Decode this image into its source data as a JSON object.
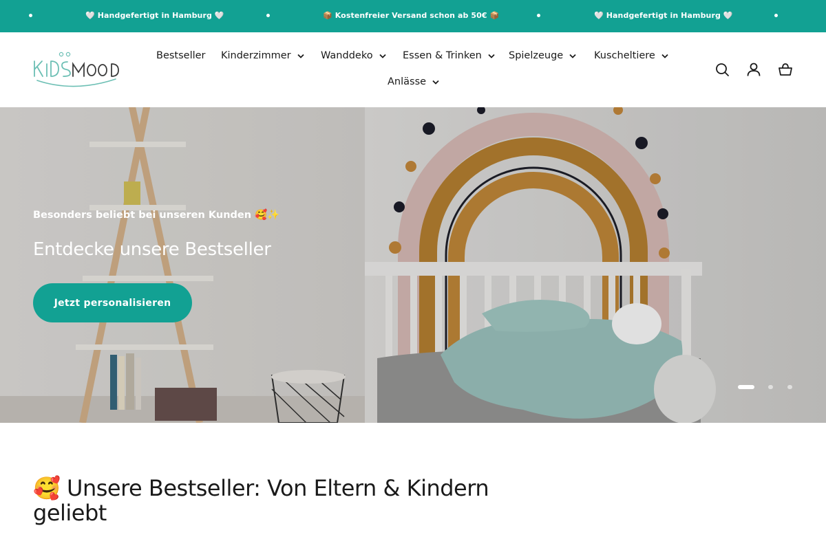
{
  "announcement": {
    "messages": [
      "🤍 Handgefertigt in Hamburg 🤍",
      "📦 Kostenfreier Versand schon ab 50€ 📦",
      "🤍 Handgefertigt in Hamburg 🤍"
    ]
  },
  "header": {
    "logo_text": "KIDSMOOD",
    "nav": [
      {
        "label": "Bestseller",
        "has_dropdown": false
      },
      {
        "label": "Kinderzimmer",
        "has_dropdown": true
      },
      {
        "label": "Wanddeko",
        "has_dropdown": true
      },
      {
        "label": "Essen & Trinken",
        "has_dropdown": true
      },
      {
        "label": "Spielzeuge",
        "has_dropdown": true
      },
      {
        "label": "Kuscheltiere",
        "has_dropdown": true
      },
      {
        "label": "Anlässe",
        "has_dropdown": true
      }
    ],
    "icons": [
      "search-icon",
      "account-icon",
      "cart-icon"
    ]
  },
  "hero": {
    "kicker": "Besonders beliebt bei unseren Kunden 🥰✨",
    "title": "Entdecke unsere Bestseller",
    "cta": "Jetzt personalisieren",
    "slides": 3,
    "active_slide": 1
  },
  "section": {
    "title": "🥰 Unsere Bestseller: Von Eltern & Kindern geliebt"
  },
  "colors": {
    "accent": "#12a193",
    "text": "#1a1a1a",
    "background": "#ffffff"
  }
}
